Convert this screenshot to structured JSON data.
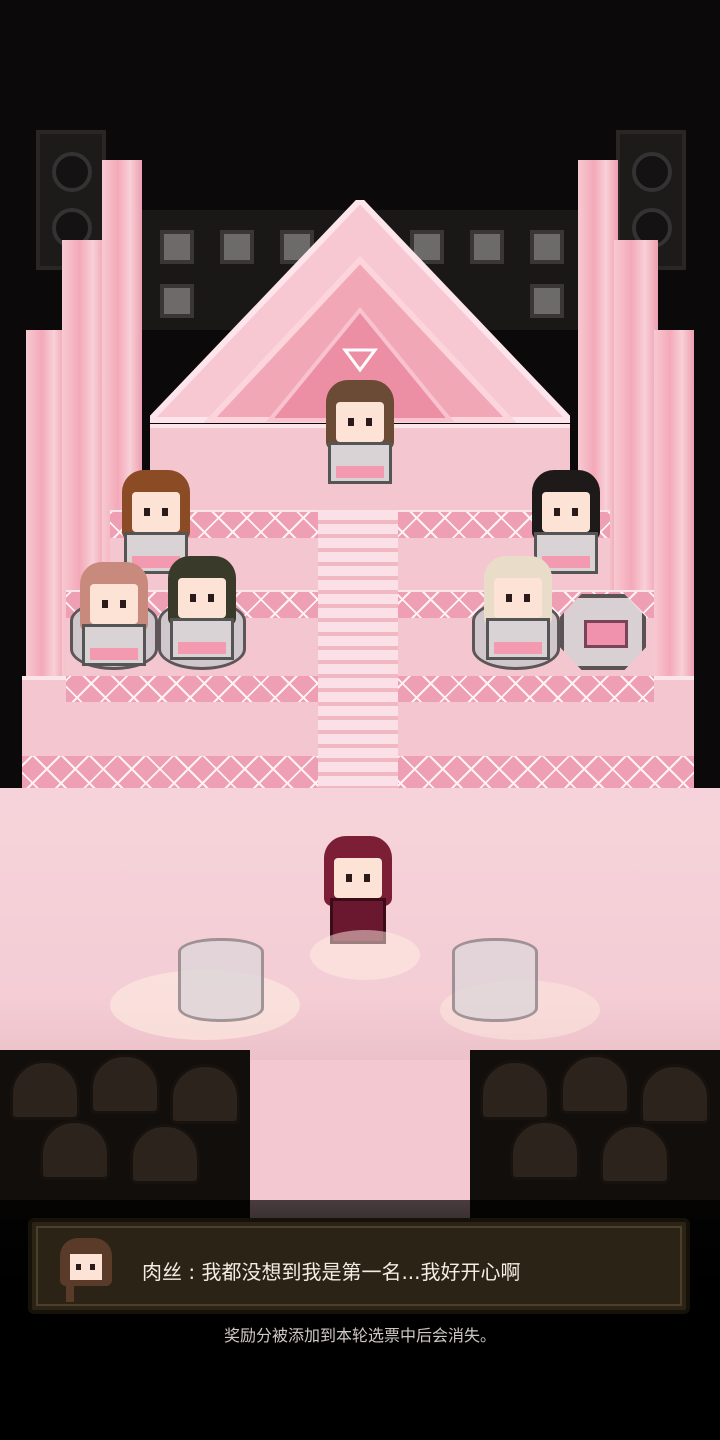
{
  "dialog": {
    "speaker_name": "肉丝",
    "separator": " : ",
    "line": "我都没想到我是第一名...我好开心啊",
    "avatar_icon": "idol-portrait-icon"
  },
  "notice": "奖励分被添加到本轮选票中后会消失。",
  "colors": {
    "stage_pink": "#f4c7d0",
    "accent_pink": "#ee9fb3",
    "dialog_bg": "#2b2416",
    "background": "#0b0909"
  }
}
